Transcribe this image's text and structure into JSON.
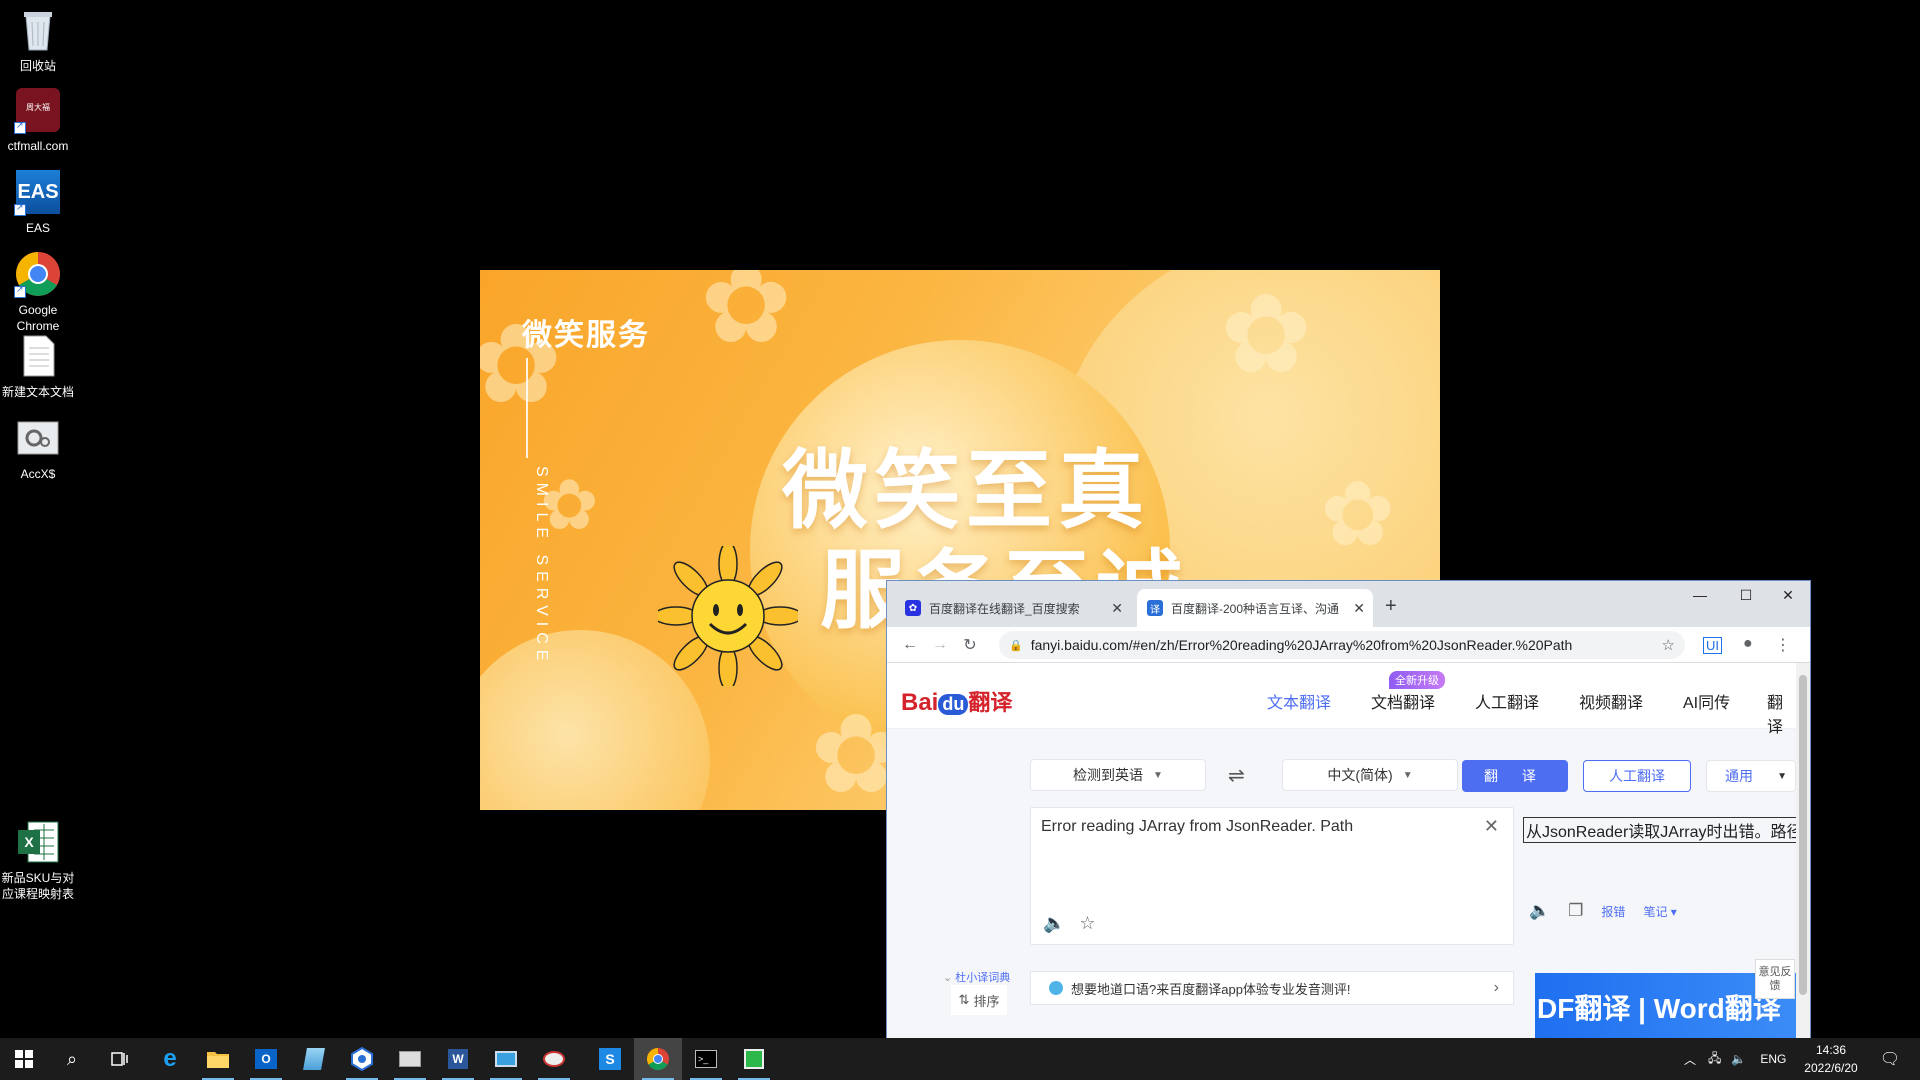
{
  "desktop": {
    "icons": [
      {
        "label": "回收站",
        "icon": "recycle-bin-icon"
      },
      {
        "label": "ctfmall.com",
        "icon": "ctfmall-icon"
      },
      {
        "label": "EAS",
        "icon": "eas-icon"
      },
      {
        "label": "Google Chrome",
        "icon": "chrome-icon"
      },
      {
        "label": "新建文本文档",
        "icon": "text-document-icon"
      },
      {
        "label": "AccX$",
        "icon": "accx-icon"
      },
      {
        "label": "新品SKU与对应课程映射表",
        "icon": "excel-icon"
      }
    ]
  },
  "poster": {
    "side_title": "微笑服务",
    "vertical_text": "SMILE SERVICE",
    "headline_1": "微笑至真",
    "headline_2": "服务至诚",
    "colors": {
      "orange": "#f9a52a",
      "light": "#fde0a0"
    }
  },
  "browser": {
    "tabs": [
      {
        "title": "百度翻译在线翻译_百度搜索",
        "active": false,
        "favicon": "baidu-paw-icon"
      },
      {
        "title": "百度翻译-200种语言互译、沟通",
        "active": true,
        "favicon": "baidu-translate-icon"
      }
    ],
    "window_controls": {
      "minimize": "—",
      "maximize": "☐",
      "close": "✕"
    },
    "url": "fanyi.baidu.com/#en/zh/Error%20reading%20JArray%20from%20JsonReader.%20Path",
    "site": {
      "logo_text": "Bai",
      "logo_du": "du",
      "logo_fy": "翻译",
      "nav": [
        {
          "label": "文本翻译",
          "active": true
        },
        {
          "label": "文档翻译",
          "active": false
        },
        {
          "label": "人工翻译",
          "active": false
        },
        {
          "label": "视频翻译",
          "active": false
        },
        {
          "label": "AI同传",
          "active": false
        },
        {
          "label": "翻译",
          "active": false
        }
      ],
      "upgrade_badge": "全新升级",
      "source_lang": "检测到英语",
      "target_lang": "中文(简体)",
      "translate_button": "翻 译",
      "human_button": "人工翻译",
      "domain_select": "通用",
      "source_text": "Error reading JArray from JsonReader. Path",
      "target_text": "从JsonReader读取JArray时出错。路径",
      "report_link": "报错",
      "notes_link": "笔记",
      "dict_label": "杜小译词典",
      "sort_label": "排序",
      "promo_text": "想要地道口语?来百度翻译app体验专业发音测评!",
      "banner_text": "DF翻译  |  Word翻译",
      "feedback_label": "意见反馈"
    },
    "accent": "#4e6ef2"
  },
  "taskbar": {
    "apps": [
      "windows-start-icon",
      "search-icon",
      "task-view-icon",
      "ie-icon",
      "file-explorer-icon",
      "outlook-icon",
      "notepad-icon",
      "network-app-icon",
      "snipping-icon",
      "word-icon",
      "remote-desktop-icon",
      "paint-icon",
      "s-app-icon",
      "chrome-icon",
      "terminal-icon",
      "media-player-icon"
    ],
    "language": "ENG",
    "time": "14:36",
    "date": "2022/6/20"
  }
}
